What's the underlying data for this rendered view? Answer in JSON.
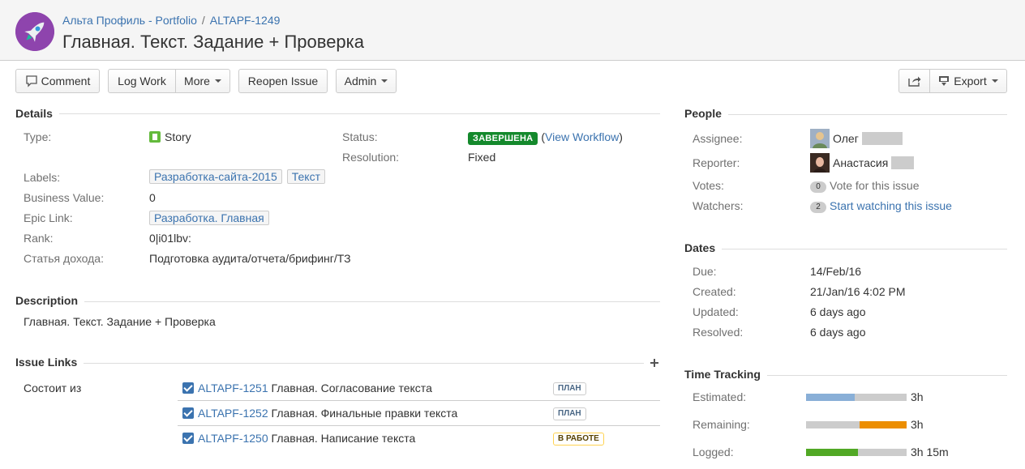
{
  "header": {
    "project": "Альта Профиль - Portfolio",
    "separator": "/",
    "issue_key": "ALTAPF-1249",
    "title": "Главная. Текст. Задание + Проверка"
  },
  "toolbar": {
    "comment": "Comment",
    "log_work": "Log Work",
    "more": "More",
    "reopen": "Reopen Issue",
    "admin": "Admin",
    "export": "Export"
  },
  "details": {
    "heading": "Details",
    "type_label": "Type:",
    "type_value": "Story",
    "status_label": "Status:",
    "status_value": "ЗАВЕРШЕНА",
    "view_workflow": "View Workflow",
    "resolution_label": "Resolution:",
    "resolution_value": "Fixed",
    "labels_label": "Labels:",
    "labels": [
      "Разработка-сайта-2015",
      "Текст"
    ],
    "business_value_label": "Business Value:",
    "business_value": "0",
    "epic_link_label": "Epic Link:",
    "epic_link": "Разработка. Главная",
    "rank_label": "Rank:",
    "rank_value": "0|i01lbv:",
    "income_label": "Статья дохода:",
    "income_value": "Подготовка аудита/отчета/брифинг/ТЗ"
  },
  "description": {
    "heading": "Description",
    "text": "Главная. Текст. Задание + Проверка"
  },
  "issue_links": {
    "heading": "Issue Links",
    "relation": "Состоит из",
    "items": [
      {
        "key": "ALTAPF-1251",
        "summary": "Главная. Согласование текста",
        "status": "ПЛАН"
      },
      {
        "key": "ALTAPF-1252",
        "summary": "Главная. Финальные правки текста",
        "status": "ПЛАН"
      },
      {
        "key": "ALTAPF-1250",
        "summary": "Главная. Написание текста",
        "status": "В РАБОТЕ"
      }
    ]
  },
  "people": {
    "heading": "People",
    "assignee_label": "Assignee:",
    "assignee": "Олег",
    "reporter_label": "Reporter:",
    "reporter": "Анастасия",
    "votes_label": "Votes:",
    "votes_count": "0",
    "votes_text": "Vote for this issue",
    "watchers_label": "Watchers:",
    "watchers_count": "2",
    "watchers_text": "Start watching this issue"
  },
  "dates": {
    "heading": "Dates",
    "due_label": "Due:",
    "due": "14/Feb/16",
    "created_label": "Created:",
    "created": "21/Jan/16 4:02 PM",
    "updated_label": "Updated:",
    "updated": "6 days ago",
    "resolved_label": "Resolved:",
    "resolved": "6 days ago"
  },
  "time_tracking": {
    "heading": "Time Tracking",
    "estimated_label": "Estimated:",
    "estimated": "3h",
    "estimated_fraction": 0.48,
    "remaining_label": "Remaining:",
    "remaining": "3h",
    "remaining_fraction": 0.47,
    "logged_label": "Logged:",
    "logged": "3h 15m",
    "logged_fraction": 0.52,
    "colors": {
      "estimated": "#89afd7",
      "remaining": "#ec8e00",
      "logged": "#51a825"
    }
  }
}
